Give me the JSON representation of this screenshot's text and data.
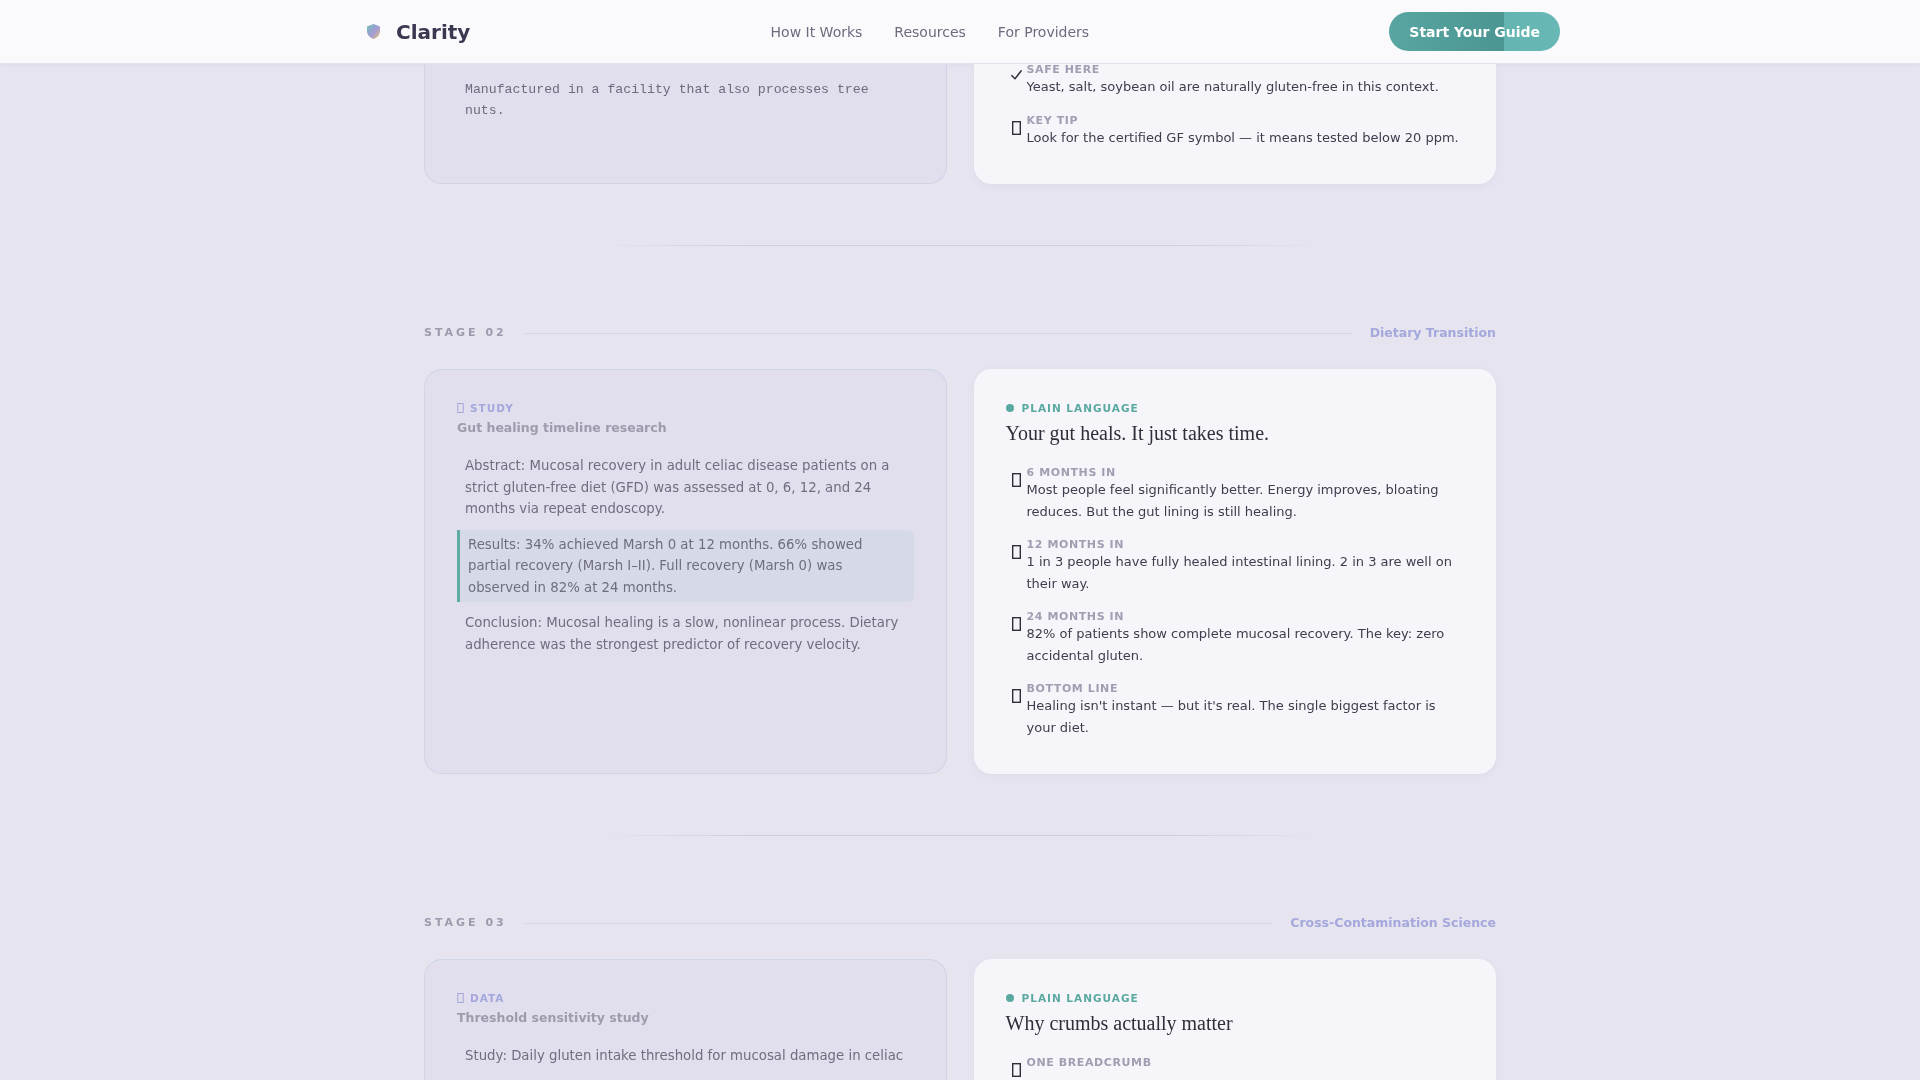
{
  "header": {
    "brand": "Clarity",
    "nav": [
      "How It Works",
      "Resources",
      "For Providers"
    ],
    "cta": "Start Your Guide"
  },
  "sections": [
    {
      "technical": {
        "paragraphs": [
          {
            "kind": "mono",
            "text": "Manufactured in a facility that also processes tree nuts."
          }
        ]
      },
      "plain": {
        "items": [
          {
            "kind": "check",
            "label": "SAFE HERE",
            "text": "Yeast, salt, soybean oil are naturally gluten-free in this context."
          },
          {
            "kind": "note",
            "label": "KEY TIP",
            "text": "Look for the certified GF symbol — it means tested below 20 ppm."
          }
        ]
      }
    },
    {
      "stage": "STAGE 02",
      "topic": "Dietary Transition",
      "technical": {
        "tag": "STUDY",
        "title": "Gut healing timeline research",
        "paragraphs": [
          {
            "kind": "body",
            "text": "Abstract: Mucosal recovery in adult celiac disease patients on a strict gluten-free diet (GFD) was assessed at 0, 6, 12, and 24 months via repeat endoscopy."
          },
          {
            "kind": "highlight",
            "text": "Results: 34% achieved Marsh 0 at 12 months. 66% showed partial recovery (Marsh I–II). Full recovery (Marsh 0) was observed in 82% at 24 months."
          },
          {
            "kind": "body",
            "text": "Conclusion: Mucosal healing is a slow, nonlinear process. Dietary adherence was the strongest predictor of recovery velocity."
          }
        ]
      },
      "plain": {
        "tag": "PLAIN LANGUAGE",
        "title": "Your gut heals. It just takes time.",
        "items": [
          {
            "kind": "note",
            "label": "6 MONTHS IN",
            "text": "Most people feel significantly better. Energy improves, bloating reduces. But the gut lining is still healing."
          },
          {
            "kind": "note",
            "label": "12 MONTHS IN",
            "text": "1 in 3 people have fully healed intestinal lining. 2 in 3 are well on their way."
          },
          {
            "kind": "note",
            "label": "24 MONTHS IN",
            "text": "82% of patients show complete mucosal recovery. The key: zero accidental gluten."
          },
          {
            "kind": "note",
            "label": "BOTTOM LINE",
            "text": "Healing isn't instant — but it's real. The single biggest factor is your diet."
          }
        ]
      }
    },
    {
      "stage": "STAGE 03",
      "topic": "Cross-Contamination Science",
      "technical": {
        "tag": "DATA",
        "title": "Threshold sensitivity study",
        "paragraphs": [
          {
            "kind": "body",
            "text": "Study: Daily gluten intake threshold for mucosal damage in celiac"
          }
        ]
      },
      "plain": {
        "tag": "PLAIN LANGUAGE",
        "title": "Why crumbs actually matter",
        "items": [
          {
            "kind": "note",
            "label": "ONE BREADCRUMB"
          }
        ]
      }
    }
  ]
}
